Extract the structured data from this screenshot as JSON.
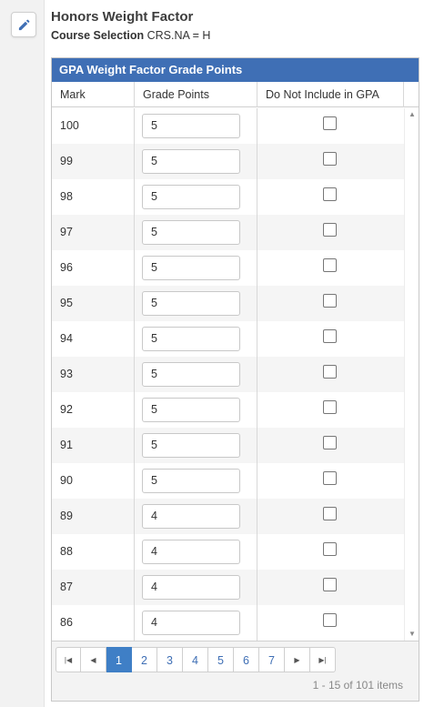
{
  "header": {
    "title": "Honors Weight Factor",
    "course_label": "Course Selection",
    "course_value": "CRS.NA = H"
  },
  "grid": {
    "title": "GPA Weight Factor Grade Points",
    "columns": [
      "Mark",
      "Grade Points",
      "Do Not Include in GPA"
    ],
    "rows": [
      {
        "mark": "100",
        "points": "5",
        "exclude": false
      },
      {
        "mark": "99",
        "points": "5",
        "exclude": false
      },
      {
        "mark": "98",
        "points": "5",
        "exclude": false
      },
      {
        "mark": "97",
        "points": "5",
        "exclude": false
      },
      {
        "mark": "96",
        "points": "5",
        "exclude": false
      },
      {
        "mark": "95",
        "points": "5",
        "exclude": false
      },
      {
        "mark": "94",
        "points": "5",
        "exclude": false
      },
      {
        "mark": "93",
        "points": "5",
        "exclude": false
      },
      {
        "mark": "92",
        "points": "5",
        "exclude": false
      },
      {
        "mark": "91",
        "points": "5",
        "exclude": false
      },
      {
        "mark": "90",
        "points": "5",
        "exclude": false
      },
      {
        "mark": "89",
        "points": "4",
        "exclude": false
      },
      {
        "mark": "88",
        "points": "4",
        "exclude": false
      },
      {
        "mark": "87",
        "points": "4",
        "exclude": false
      },
      {
        "mark": "86",
        "points": "4",
        "exclude": false
      }
    ]
  },
  "pager": {
    "first_icon": "first-page-icon",
    "prev_icon": "prev-page-icon",
    "next_icon": "next-page-icon",
    "last_icon": "last-page-icon",
    "pages": [
      "1",
      "2",
      "3",
      "4",
      "5",
      "6",
      "7"
    ],
    "active_page": "1",
    "info": "1 - 15 of 101 items"
  },
  "icons": {
    "edit": "pencil-icon"
  },
  "colors": {
    "header_blue": "#3f6fb5",
    "active_page": "#3f7fc6"
  }
}
